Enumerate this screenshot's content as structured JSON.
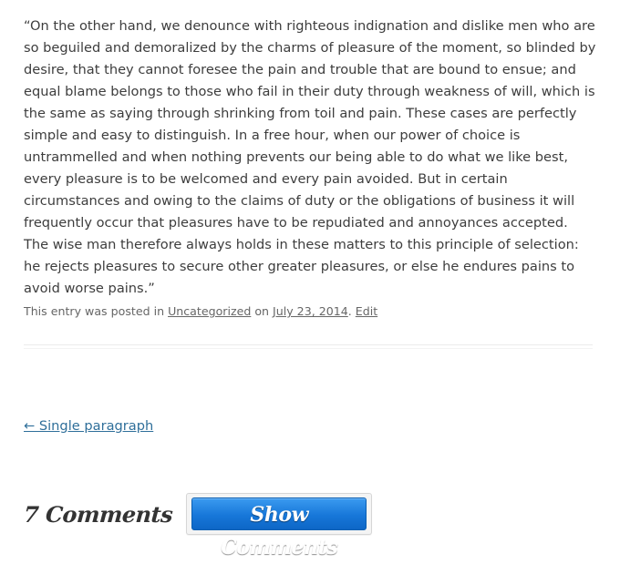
{
  "entry": {
    "text": "“On the other hand, we denounce with righteous indignation and dislike men who are so beguiled and demoralized by the charms of pleasure of the moment, so blinded by desire, that they cannot foresee the pain and trouble that are bound to ensue; and equal blame belongs to those who fail in their duty through weakness of will, which is the same as saying through shrinking from toil and pain. These cases are perfectly simple and easy to distinguish. In a free hour, when our power of choice is untrammelled and when nothing prevents our being able to do what we like best, every pleasure is to be welcomed and every pain avoided. But in certain circumstances and owing to the claims of duty or the obligations of business it will frequently occur that pleasures have to be repudiated and annoyances accepted. The wise man therefore always holds in these matters to this principle of selection: he rejects pleasures to secure other greater pleasures, or else he endures pains to avoid worse pains.”"
  },
  "meta": {
    "posted_in_prefix": "This entry was posted in ",
    "category": "Uncategorized",
    "on_text": " on ",
    "date": "July 23, 2014",
    "separator": ". ",
    "edit_label": "Edit"
  },
  "navigation": {
    "previous_label": "← Single paragraph"
  },
  "comments": {
    "count_label": "7 Comments",
    "show_button_label": "Show Comments"
  },
  "colors": {
    "link": "#2f6f9a",
    "button": "#1777d9"
  }
}
